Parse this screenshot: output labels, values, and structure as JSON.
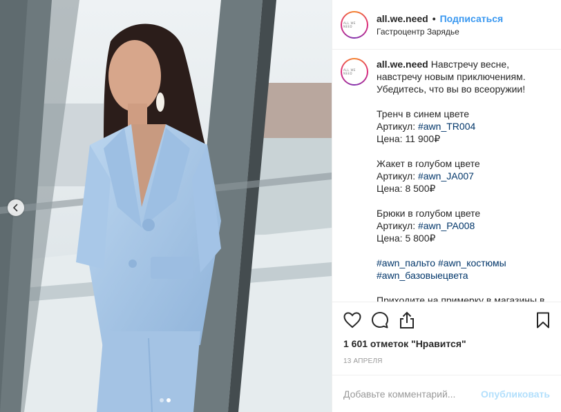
{
  "header": {
    "username": "all.we.need",
    "separator": "•",
    "follow_label": "Подписаться",
    "location": "Гастроцентр Зарядье",
    "avatar_text": "ALL WE NEED"
  },
  "caption": {
    "username": "all.we.need",
    "intro": "Навстречу весне, навстречу новым приключениям. Убедитесь, что вы во всеоружии!",
    "items": [
      {
        "name": "Тренч в синем цвете",
        "article_label": "Артикул:",
        "tag": "#awn_TR004",
        "price": "Цена: 11 900₽"
      },
      {
        "name": "Жакет в голубом цвете",
        "article_label": "Артикул:",
        "tag": "#awn_JA007",
        "price": "Цена: 8 500₽"
      },
      {
        "name": "Брюки в голубом цвете",
        "article_label": "Артикул:",
        "tag": "#awn_PA008",
        "price": "Цена: 5 800₽"
      }
    ],
    "hashtags": [
      "#awn_пальто",
      "#awn_костюмы",
      "#awn_базовыецвета"
    ],
    "outro": "Приходите на примерку в магазины в"
  },
  "stats": {
    "likes": "1 601 отметок \"Нравится\"",
    "date": "13 апреля"
  },
  "comment": {
    "placeholder": "Добавьте комментарий...",
    "post_label": "Опубликовать"
  },
  "carousel": {
    "current": 2,
    "total": 2
  },
  "icons": {
    "like": "heart-icon",
    "comment": "comment-icon",
    "share": "share-icon",
    "save": "bookmark-icon",
    "prev": "chevron-left-icon"
  },
  "colors": {
    "follow": "#3897f0",
    "hashtag": "#003569",
    "post_button_disabled": "#b2dffc",
    "suit": "#a9c8e8"
  }
}
